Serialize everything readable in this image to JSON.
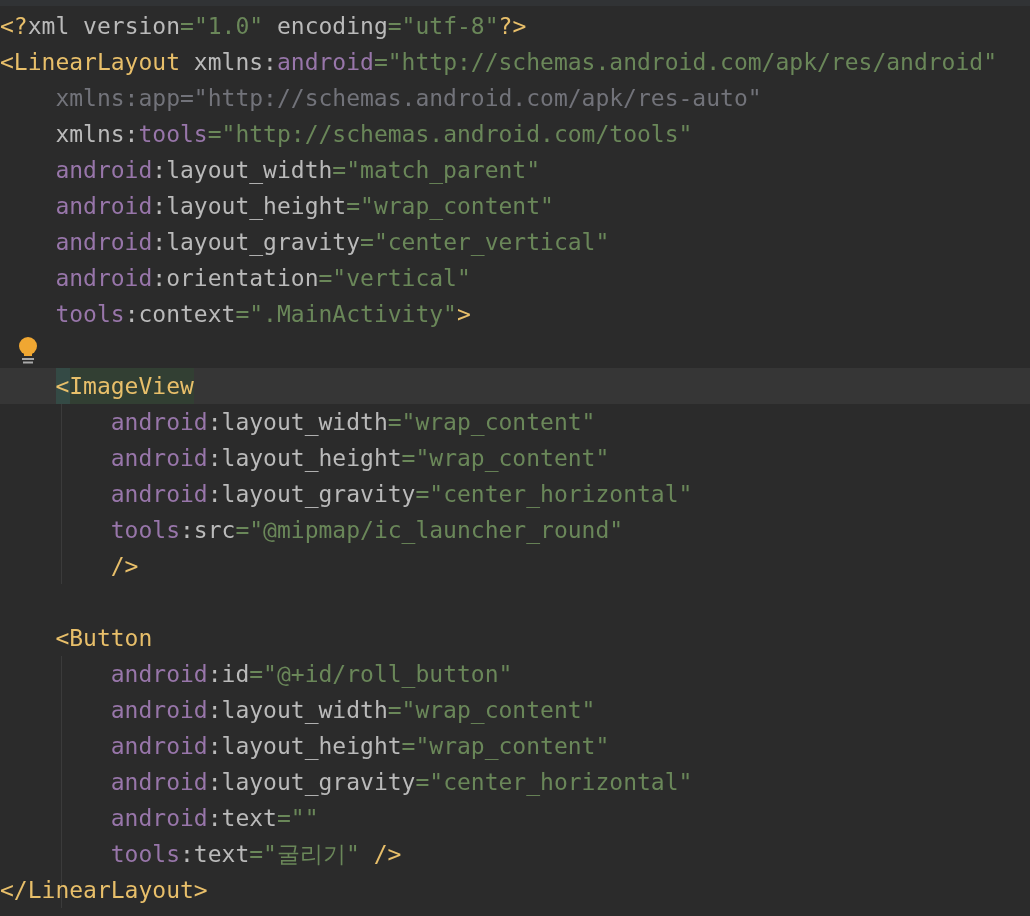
{
  "editor": {
    "lines": [
      {
        "kind": "code",
        "guide": false,
        "tokens": [
          {
            "kind": "tag",
            "text": "<?"
          },
          {
            "kind": "plain",
            "text": "xml version"
          },
          {
            "kind": "value",
            "text": "=\"1.0\""
          },
          {
            "kind": "plain",
            "text": " encoding"
          },
          {
            "kind": "value",
            "text": "=\"utf-8\""
          },
          {
            "kind": "tag",
            "text": "?>"
          }
        ]
      },
      {
        "kind": "code",
        "guide": false,
        "tokens": [
          {
            "kind": "tag",
            "text": "<LinearLayout"
          },
          {
            "kind": "plain",
            "text": " xmlns:"
          },
          {
            "kind": "ns",
            "text": "android"
          },
          {
            "kind": "value",
            "text": "=\"http://schemas.android.com/apk/res/android\""
          }
        ]
      },
      {
        "kind": "code",
        "guide": false,
        "tokens": [
          {
            "kind": "dim",
            "text": "    xmlns:app=\"http://schemas.android.com/apk/res-auto\""
          }
        ]
      },
      {
        "kind": "code",
        "guide": false,
        "tokens": [
          {
            "kind": "plain",
            "text": "    xmlns:"
          },
          {
            "kind": "ns",
            "text": "tools"
          },
          {
            "kind": "value",
            "text": "=\"http://schemas.android.com/tools\""
          }
        ]
      },
      {
        "kind": "code",
        "guide": false,
        "tokens": [
          {
            "kind": "ns",
            "text": "    android"
          },
          {
            "kind": "plain",
            "text": ":layout_width"
          },
          {
            "kind": "value",
            "text": "=\"match_parent\""
          }
        ]
      },
      {
        "kind": "code",
        "guide": false,
        "tokens": [
          {
            "kind": "ns",
            "text": "    android"
          },
          {
            "kind": "plain",
            "text": ":layout_height"
          },
          {
            "kind": "value",
            "text": "=\"wrap_content\""
          }
        ]
      },
      {
        "kind": "code",
        "guide": false,
        "tokens": [
          {
            "kind": "ns",
            "text": "    android"
          },
          {
            "kind": "plain",
            "text": ":layout_gravity"
          },
          {
            "kind": "value",
            "text": "=\"center_vertical\""
          }
        ]
      },
      {
        "kind": "code",
        "guide": false,
        "tokens": [
          {
            "kind": "ns",
            "text": "    android"
          },
          {
            "kind": "plain",
            "text": ":orientation"
          },
          {
            "kind": "value",
            "text": "=\"vertical\""
          }
        ]
      },
      {
        "kind": "code",
        "guide": false,
        "tokens": [
          {
            "kind": "ns",
            "text": "    tools"
          },
          {
            "kind": "plain",
            "text": ":context"
          },
          {
            "kind": "value",
            "text": "=\".MainActivity\""
          },
          {
            "kind": "tag",
            "text": ">"
          }
        ]
      },
      {
        "kind": "hint",
        "guide": false
      },
      {
        "kind": "current",
        "guide": false,
        "tokens": [
          {
            "kind": "tag-match",
            "text": "    <ImageView"
          }
        ]
      },
      {
        "kind": "code",
        "guide": true,
        "tokens": [
          {
            "kind": "ns",
            "text": "        android"
          },
          {
            "kind": "plain",
            "text": ":layout_width"
          },
          {
            "kind": "value",
            "text": "=\"wrap_content\""
          }
        ]
      },
      {
        "kind": "code",
        "guide": true,
        "tokens": [
          {
            "kind": "ns",
            "text": "        android"
          },
          {
            "kind": "plain",
            "text": ":layout_height"
          },
          {
            "kind": "value",
            "text": "=\"wrap_content\""
          }
        ]
      },
      {
        "kind": "code",
        "guide": true,
        "tokens": [
          {
            "kind": "ns",
            "text": "        android"
          },
          {
            "kind": "plain",
            "text": ":layout_gravity"
          },
          {
            "kind": "value",
            "text": "=\"center_horizontal\""
          }
        ]
      },
      {
        "kind": "code",
        "guide": true,
        "tokens": [
          {
            "kind": "ns",
            "text": "        tools"
          },
          {
            "kind": "plain",
            "text": ":src"
          },
          {
            "kind": "value",
            "text": "=\"@mipmap/ic_launcher_round\""
          }
        ]
      },
      {
        "kind": "code",
        "guide": true,
        "tokens": [
          {
            "kind": "tag",
            "text": "        />"
          }
        ]
      },
      {
        "kind": "code",
        "guide": false
      },
      {
        "kind": "code",
        "guide": false,
        "tokens": [
          {
            "kind": "tag",
            "text": "    <Button"
          }
        ]
      },
      {
        "kind": "code",
        "guide": true,
        "tokens": [
          {
            "kind": "ns",
            "text": "        android"
          },
          {
            "kind": "plain",
            "text": ":id"
          },
          {
            "kind": "value",
            "text": "=\"@+id/roll_button\""
          }
        ]
      },
      {
        "kind": "code",
        "guide": true,
        "tokens": [
          {
            "kind": "ns",
            "text": "        android"
          },
          {
            "kind": "plain",
            "text": ":layout_width"
          },
          {
            "kind": "value",
            "text": "=\"wrap_content\""
          }
        ]
      },
      {
        "kind": "code",
        "guide": true,
        "tokens": [
          {
            "kind": "ns",
            "text": "        android"
          },
          {
            "kind": "plain",
            "text": ":layout_height"
          },
          {
            "kind": "value",
            "text": "=\"wrap_content\""
          }
        ]
      },
      {
        "kind": "code",
        "guide": true,
        "tokens": [
          {
            "kind": "ns",
            "text": "        android"
          },
          {
            "kind": "plain",
            "text": ":layout_gravity"
          },
          {
            "kind": "value",
            "text": "=\"center_horizontal\""
          }
        ]
      },
      {
        "kind": "code",
        "guide": true,
        "tokens": [
          {
            "kind": "ns",
            "text": "        android"
          },
          {
            "kind": "plain",
            "text": ":text"
          },
          {
            "kind": "value",
            "text": "=\"\""
          }
        ]
      },
      {
        "kind": "code",
        "guide": true,
        "tokens": [
          {
            "kind": "ns",
            "text": "        tools"
          },
          {
            "kind": "plain",
            "text": ":text"
          },
          {
            "kind": "value",
            "text": "=\"굴리기\""
          },
          {
            "kind": "tag",
            "text": " />"
          }
        ]
      },
      {
        "kind": "code",
        "guide": true,
        "tokens": [
          {
            "kind": "tag",
            "text": "</LinearLayout>"
          }
        ]
      }
    ]
  }
}
